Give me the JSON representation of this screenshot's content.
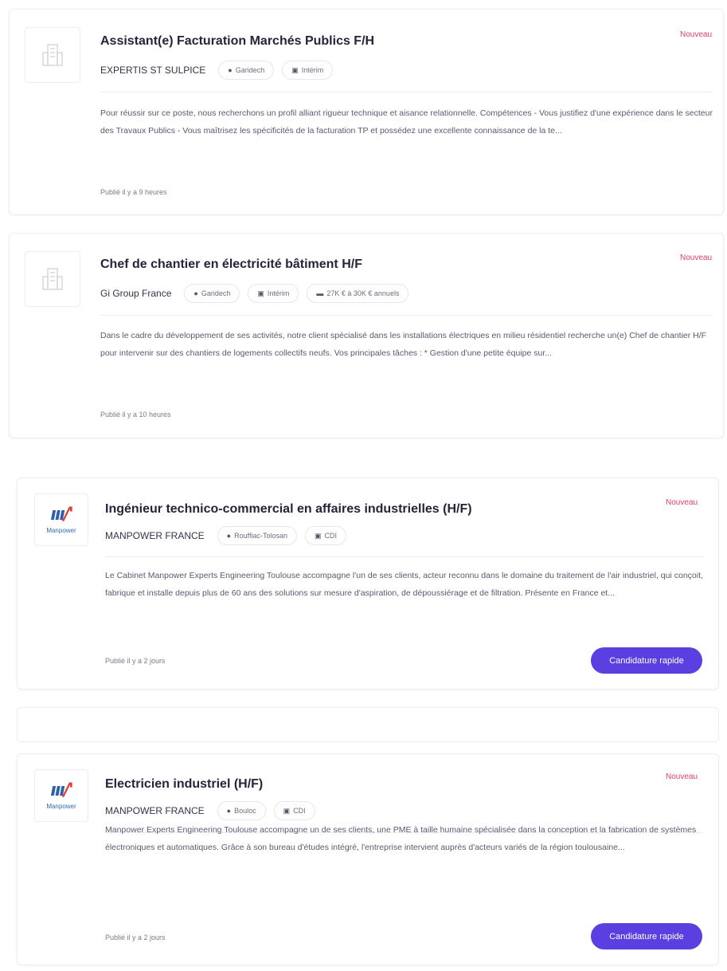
{
  "jobs": [
    {
      "title": "Assistant(e) Facturation Marchés Publics F/H",
      "badge": "Nouveau",
      "company": "EXPERTIS ST SULPICE",
      "tags": [
        "Garidech",
        "Intérim"
      ],
      "description": "Pour réussir sur ce poste, nous recherchons un profil alliant rigueur technique et aisance relationnelle. Compétences - Vous justifiez d'une expérience dans le secteur des Travaux Publics - Vous maîtrisez les spécificités de la facturation TP et possédez une excellente connaissance de la te...",
      "posted": "Publié il y a 9 heures"
    },
    {
      "title": "Chef de chantier en électricité bâtiment H/F",
      "badge": "Nouveau",
      "company": "Gi Group France",
      "tags": [
        "Garidech",
        "Intérim",
        "27K € à 30K € annuels"
      ],
      "description": "Dans le cadre du développement de ses activités, notre client spécialisé dans les installations électriques en milieu résidentiel recherche un(e) Chef de chantier H/F pour intervenir sur des chantiers de logements collectifs neufs. Vos principales tâches : * Gestion d'une petite équipe sur...",
      "posted": "Publié il y a 10 heures"
    },
    {
      "title": "Ingénieur technico-commercial en affaires industrielles (H/F)",
      "badge": "Nouveau",
      "company": "MANPOWER FRANCE",
      "logo_word": "Manpower",
      "tags": [
        "Rouffiac-Tolosan",
        "CDI"
      ],
      "description": "Le Cabinet Manpower Experts Engineering Toulouse accompagne l'un de ses clients, acteur reconnu dans le domaine du traitement de l'air industriel, qui conçoit, fabrique et installe depuis plus de 60 ans des solutions sur mesure d'aspiration, de dépoussiérage et de filtration. Présente en France et...",
      "posted": "Publié il y a 2 jours",
      "apply_label": "Candidature rapide"
    },
    {
      "title": "Electricien industriel (H/F)",
      "badge": "Nouveau",
      "company": "MANPOWER FRANCE",
      "logo_word": "Manpower",
      "tags": [
        "Bouloc",
        "CDI"
      ],
      "description": "Manpower Experts Engineering Toulouse accompagne un de ses clients, une PME à taille humaine spécialisée dans la conception et la fabrication de systèmes électroniques et automatiques.    Grâce à son bureau d'études intégré, l'entreprise intervient auprès d'acteurs variés de la région toulousaine...",
      "posted": "Publié il y a 2 jours",
      "apply_label": "Candidature rapide"
    }
  ],
  "icons": {
    "location": "map-pin-icon",
    "contract": "document-icon",
    "salary": "banknote-icon",
    "company_placeholder": "building-icon"
  },
  "colors": {
    "accent": "#5b3fe0",
    "badge": "#e0406c"
  }
}
